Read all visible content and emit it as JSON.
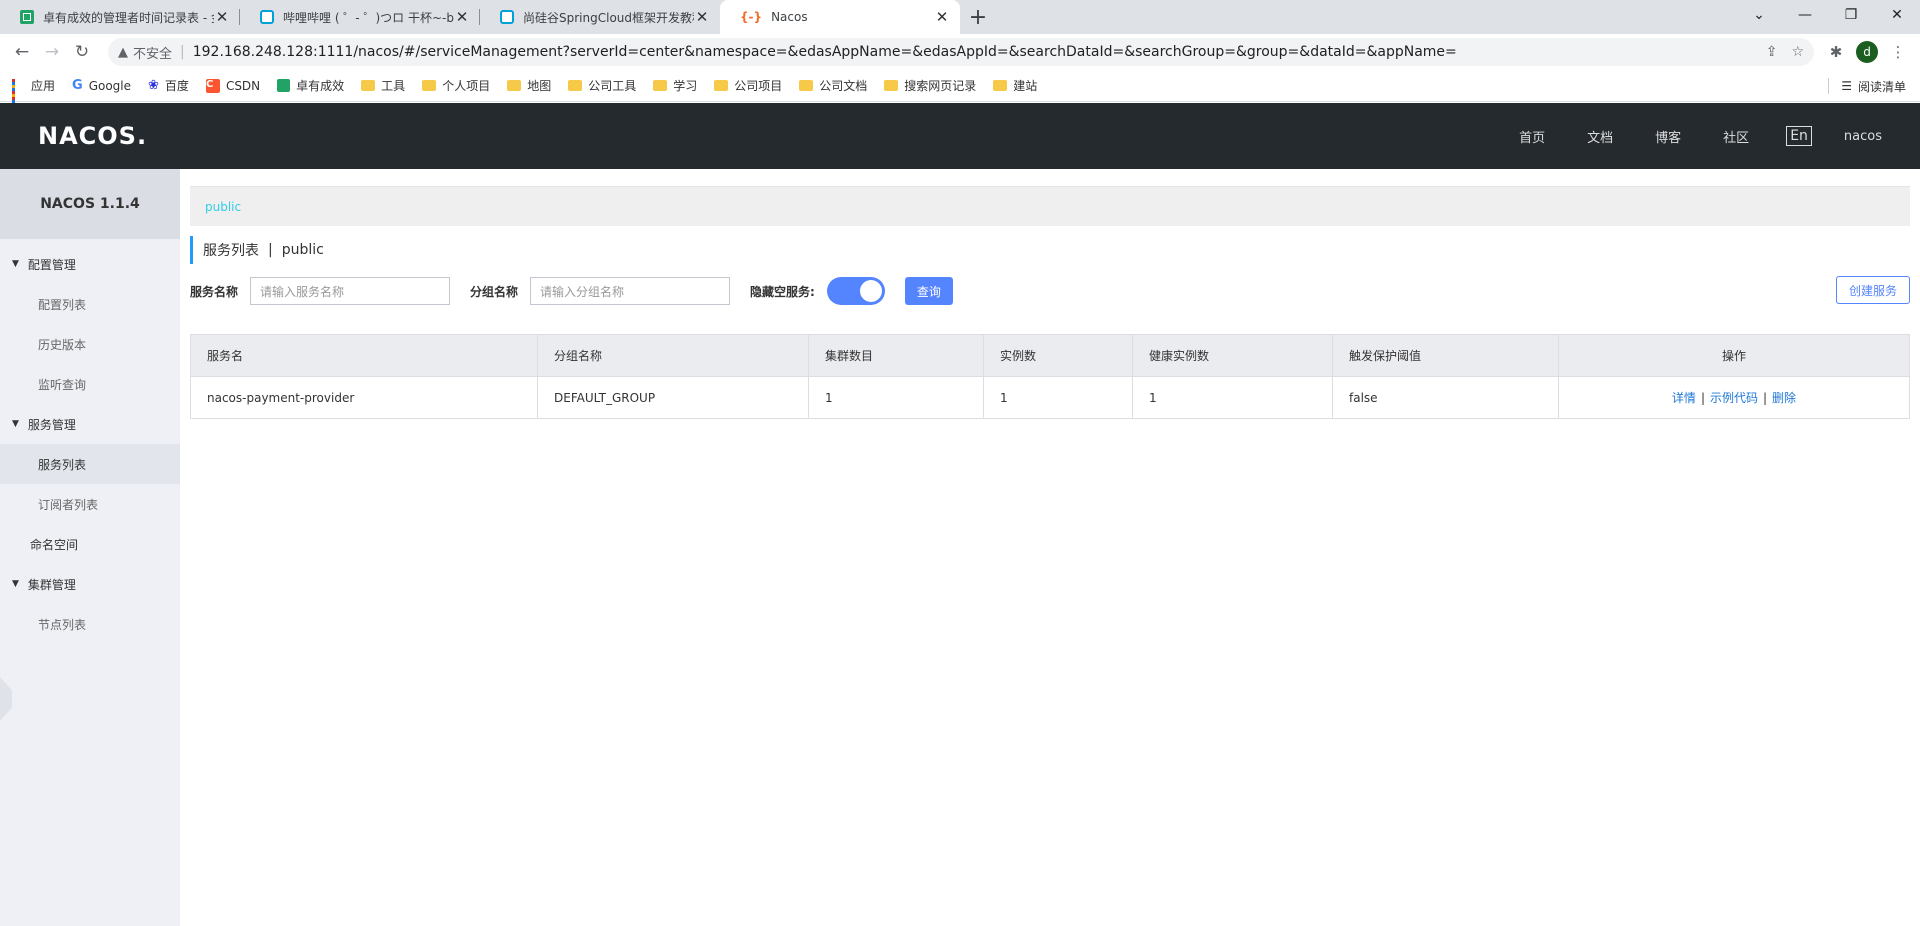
{
  "browser": {
    "tabs": [
      {
        "title": "卓有成效的管理者时间记录表 - 金",
        "icon": "sheet-icon"
      },
      {
        "title": "哔哩哔哩 ( ゜- ゜)つロ 干杯~-bili",
        "icon": "bilibili-icon"
      },
      {
        "title": "尚硅谷SpringCloud框架开发教程",
        "icon": "bilibili-icon"
      },
      {
        "title": "Nacos",
        "icon": "nacos-icon"
      }
    ],
    "insecure_label": "不安全",
    "url": "192.168.248.128:1111/nacos/#/serviceManagement?serverId=center&namespace=&edasAppName=&edasAppId=&searchDataId=&searchGroup=&group=&dataId=&appName=",
    "avatar_letter": "d",
    "bookmarks": [
      {
        "label": "应用",
        "icon": "apps-icon"
      },
      {
        "label": "Google",
        "icon": "google-icon"
      },
      {
        "label": "百度",
        "icon": "baidu-icon"
      },
      {
        "label": "CSDN",
        "icon": "csdn-icon"
      },
      {
        "label": "卓有成效",
        "icon": "sheet-icon"
      },
      {
        "label": "工具",
        "icon": "folder-icon"
      },
      {
        "label": "个人项目",
        "icon": "folder-icon"
      },
      {
        "label": "地图",
        "icon": "folder-icon"
      },
      {
        "label": "公司工具",
        "icon": "folder-icon"
      },
      {
        "label": "学习",
        "icon": "folder-icon"
      },
      {
        "label": "公司项目",
        "icon": "folder-icon"
      },
      {
        "label": "公司文档",
        "icon": "folder-icon"
      },
      {
        "label": "搜索网页记录",
        "icon": "folder-icon"
      },
      {
        "label": "建站",
        "icon": "folder-icon"
      }
    ],
    "reading_list": "阅读清单"
  },
  "header": {
    "logo": "NACOS.",
    "menu": [
      "首页",
      "文档",
      "博客",
      "社区"
    ],
    "lang": "En",
    "user": "nacos"
  },
  "sidebar": {
    "version": "NACOS 1.1.4",
    "groups": {
      "config": "配置管理",
      "config_items": [
        "配置列表",
        "历史版本",
        "监听查询"
      ],
      "service": "服务管理",
      "service_items": [
        "服务列表",
        "订阅者列表"
      ],
      "namespace": "命名空间",
      "cluster": "集群管理",
      "cluster_items": [
        "节点列表"
      ]
    }
  },
  "main": {
    "namespace": "public",
    "title": "服务列表",
    "title_sep": "|",
    "title_ns": "public",
    "filters": {
      "service_label": "服务名称",
      "service_placeholder": "请输入服务名称",
      "group_label": "分组名称",
      "group_placeholder": "请输入分组名称",
      "hide_empty_label": "隐藏空服务:",
      "hide_empty_on": true,
      "query": "查询",
      "create": "创建服务"
    },
    "table": {
      "columns": [
        "服务名",
        "分组名称",
        "集群数目",
        "实例数",
        "健康实例数",
        "触发保护阈值",
        "操作"
      ],
      "rows": [
        {
          "name": "nacos-payment-provider",
          "group": "DEFAULT_GROUP",
          "clusters": "1",
          "instances": "1",
          "healthy": "1",
          "threshold": "false"
        }
      ],
      "ops": {
        "detail": "详情",
        "sample": "示例代码",
        "delete": "删除",
        "sep": "|"
      }
    }
  },
  "colors": {
    "accent": "#5584ff",
    "nav_bg": "#252a2f",
    "sidebar_bg": "#eef0f5",
    "namespace_link": "#33cde5"
  }
}
